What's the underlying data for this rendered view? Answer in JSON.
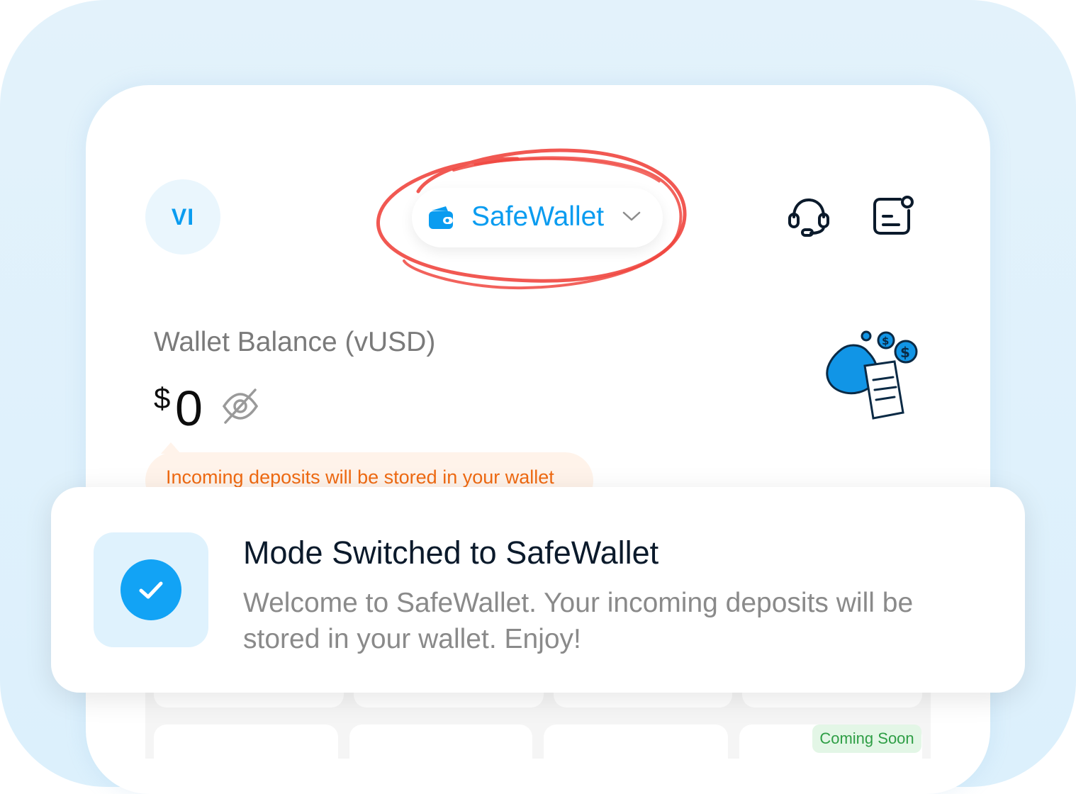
{
  "header": {
    "avatar_initials": "VI",
    "mode_selector_label": "SafeWallet",
    "icons": [
      "wallet-icon",
      "chevron-down-icon",
      "headset-icon",
      "notes-icon"
    ]
  },
  "balance": {
    "label": "Wallet Balance (vUSD)",
    "currency_symbol": "$",
    "amount": "0",
    "visibility_icon": "eye-off-icon"
  },
  "info_pill": {
    "text": "Incoming deposits will be stored in your wallet",
    "color": "#ef6a12"
  },
  "grid": {
    "badge": "Coming Soon"
  },
  "toast": {
    "title": "Mode Switched to SafeWallet",
    "message": "Welcome to SafeWallet. Your incoming deposits will be stored in your wallet. Enjoy!",
    "icon": "check-icon"
  },
  "colors": {
    "accent": "#0a9cf0",
    "annotation": "#f0463f",
    "warning": "#ef6a12",
    "success": "#2e9e45"
  }
}
